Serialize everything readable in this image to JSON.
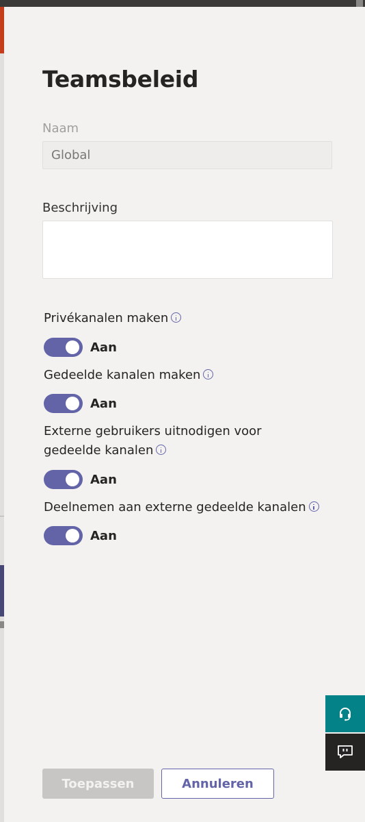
{
  "panel": {
    "title": "Teamsbeleid",
    "name_field": {
      "label": "Naam",
      "value": "Global"
    },
    "description_field": {
      "label": "Beschrijving",
      "value": ""
    }
  },
  "settings": [
    {
      "label": "Privékanalen maken",
      "state": "Aan",
      "enabled": true
    },
    {
      "label": "Gedeelde kanalen maken",
      "state": "Aan",
      "enabled": true
    },
    {
      "label": "Externe gebruikers uitnodigen voor gedeelde kanalen",
      "state": "Aan",
      "enabled": true
    },
    {
      "label": "Deelnemen aan externe gedeelde kanalen",
      "state": "Aan",
      "enabled": true
    }
  ],
  "side_buttons": {
    "help_icon": "headset-icon",
    "feedback_icon": "feedback-icon"
  },
  "footer": {
    "apply_label": "Toepassen",
    "cancel_label": "Annuleren"
  },
  "colors": {
    "accent": "#6264a7",
    "help_bg": "#038387",
    "feedback_bg": "#252423",
    "disabled_button": "#c8c6c4"
  }
}
